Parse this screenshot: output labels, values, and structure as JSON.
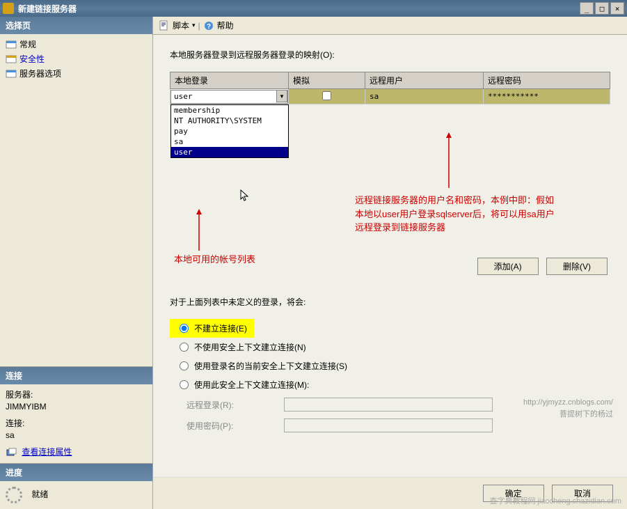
{
  "window": {
    "title": "新建链接服务器",
    "min": "_",
    "max": "□",
    "close": "×"
  },
  "sidebar": {
    "select_page_header": "选择页",
    "pages": [
      {
        "label": "常规"
      },
      {
        "label": "安全性"
      },
      {
        "label": "服务器选项"
      }
    ],
    "connection_header": "连接",
    "server_label": "服务器:",
    "server_value": "JIMMYIBM",
    "conn_label": "连接:",
    "conn_value": "sa",
    "view_connection": "查看连接属性",
    "progress_header": "进度",
    "progress_status": "就绪"
  },
  "toolbar": {
    "script": "脚本",
    "dropdown": "▾",
    "help": "帮助"
  },
  "content": {
    "mapping_label": "本地服务器登录到远程服务器登录的映射(O):",
    "columns": {
      "local_login": "本地登录",
      "impersonate": "模拟",
      "remote_user": "远程用户",
      "remote_password": "远程密码"
    },
    "row": {
      "local_login_value": "user",
      "remote_user_value": "sa",
      "remote_password_value": "***********"
    },
    "dropdown_options": [
      "membership",
      "NT AUTHORITY\\SYSTEM",
      "pay",
      "sa",
      "user"
    ],
    "annotations": {
      "local_list": "本地可用的帐号列表",
      "remote_desc_1": "远程链接服务器的用户名和密码，本例中即：假如",
      "remote_desc_2": "本地以user用户登录sqlserver后，将可以用sa用户",
      "remote_desc_3": "远程登录到链接服务器"
    },
    "add_button": "添加(A)",
    "delete_button": "删除(V)",
    "undefined_label": "对于上面列表中未定义的登录，将会:",
    "radios": {
      "no_connect": "不建立连接(E)",
      "no_security": "不使用安全上下文建立连接(N)",
      "current_security": "使用登录名的当前安全上下文建立连接(S)",
      "this_security": "使用此安全上下文建立连接(M):"
    },
    "remote_login_label": "远程登录(R):",
    "use_password_label": "使用密码(P):",
    "watermark_url": "http://yjmyzz.cnblogs.com/",
    "watermark_name": "菩提树下的杨过",
    "bottom_watermark_1": "查字典教程网",
    "bottom_watermark_2": "jiaocheng.chazidian.com"
  },
  "footer": {
    "ok": "确定",
    "cancel": "取消"
  }
}
